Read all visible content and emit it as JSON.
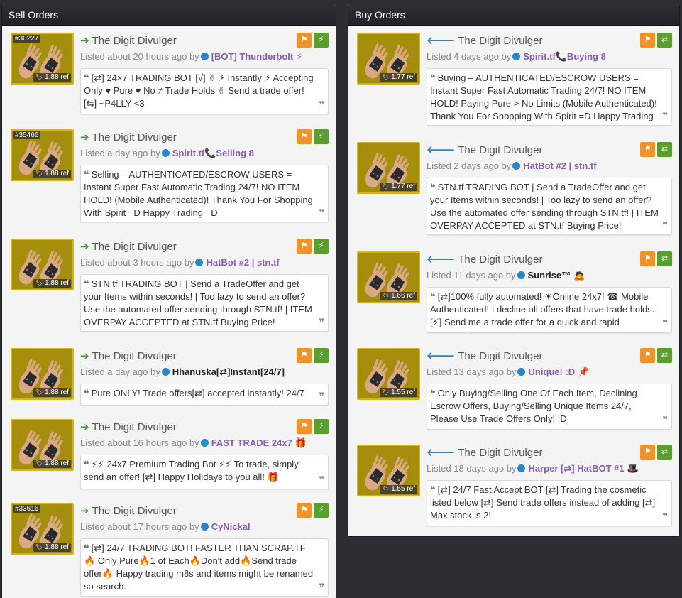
{
  "sell": {
    "title": "Sell Orders",
    "orders": [
      {
        "id": "#30227",
        "price": "1.88 ref",
        "item": "The Digit Divulger",
        "listed": "Listed about 20 hours ago by",
        "user": "[BOT] Thunderbolt",
        "user_emoji": "⚡",
        "desc": "[⇄] 24×7 TRADING BOT [√] ✌ ⚡ Instantly ⚡ Accepting Only ♥ Pure ♥ No ≠ Trade Holds ✌ Send a trade offer! [⇆] ~P4LLY <3"
      },
      {
        "id": "#35466",
        "price": "1.88 ref",
        "item": "The Digit Divulger",
        "listed": "Listed a day ago by",
        "user": "Spirit.tf📞Selling 8",
        "user_emoji": "",
        "desc": "Selling – AUTHENTICATED/ESCROW USERS = Instant Super Fast Automatic Trading 24/7! NO ITEM HOLD! (Mobile Authenticated)! Thank You For Shopping With Spirit =D Happy Trading =D"
      },
      {
        "id": "",
        "price": "1.88 ref",
        "item": "The Digit Divulger",
        "listed": "Listed about 3 hours ago by",
        "user": "HatBot #2 | stn.tf",
        "user_emoji": "",
        "desc": "STN.tf TRADING BOT | Send a TradeOffer and get your Items within seconds! | Too lazy to send an offer? Use the automated offer sending through STN.tf! | ITEM OVERPAY ACCEPTED at STN.tf Buying Price!"
      },
      {
        "id": "",
        "price": "1.88 ref",
        "item": "The Digit Divulger",
        "listed": "Listed a day ago by",
        "user": "Hhanuska[⇄]Instant[24/7]",
        "user_emoji": "",
        "desc": "Pure ONLY! Trade offers[⇄] accepted instantly! 24/7"
      },
      {
        "id": "",
        "price": "1.88 ref",
        "item": "The Digit Divulger",
        "listed": "Listed about 16 hours ago by",
        "user": "FAST TRADE 24x7",
        "user_emoji": "🎁",
        "desc": "⚡⚡ 24x7 Premium Trading Bot ⚡⚡ To trade, simply send an offer! [⇄] Happy Holidays to you all! 🎁"
      },
      {
        "id": "#33616",
        "price": "1.88 ref",
        "item": "The Digit Divulger",
        "listed": "Listed about 17 hours ago by",
        "user": "CyNickal",
        "user_emoji": "",
        "desc": "[⇄] 24/7 TRADING BOT! FASTER THAN SCRAP.TF 🔥 Only Pure🔥1 of Each🔥Don't add🔥Send trade offer🔥 Happy trading m8s and items might be renamed so search."
      }
    ]
  },
  "buy": {
    "title": "Buy Orders",
    "orders": [
      {
        "price": "1.77 ref",
        "item": "The Digit Divulger",
        "listed": "Listed 4 days ago by",
        "user": "Spirit.tf📞Buying 8",
        "user_emoji": "",
        "desc": "Buying – AUTHENTICATED/ESCROW USERS = Instant Super Fast Automatic Trading 24/7! NO ITEM HOLD! Paying Pure > No Limits (Mobile Authenticated)! Thank You For Shopping With Spirit =D Happy Trading =D"
      },
      {
        "price": "1.77 ref",
        "item": "The Digit Divulger",
        "listed": "Listed 2 days ago by",
        "user": "HatBot #2 | stn.tf",
        "user_emoji": "",
        "desc": "STN.tf TRADING BOT | Send a TradeOffer and get your Items within seconds! | Too lazy to send an offer? Use the automated offer sending through STN.tf! | ITEM OVERPAY ACCEPTED at STN.tf Buying Price!"
      },
      {
        "price": "1.66 ref",
        "item": "The Digit Divulger",
        "listed": "Listed 11 days ago by",
        "user": "Sunrise™",
        "user_emoji": "🙇",
        "desc": "[⇄]100% fully automated! ☀Online 24x7! ☎ Mobile Authenticated! I decline all offers that have trade holds. [⚡] Send me a trade offer for a quick and rapid response!"
      },
      {
        "price": "1.55 ref",
        "item": "The Digit Divulger",
        "listed": "Listed 13 days ago by",
        "user": "Unique! :D",
        "user_emoji": "📌",
        "desc": "Only Buying/Selling One Of Each Item, Declining Escrow Offers, Buying/Selling Unique Items 24/7, Please Use Trade Offers Only! :D"
      },
      {
        "price": "1.55 ref",
        "item": "The Digit Divulger",
        "listed": "Listed 18 days ago by",
        "user": "Harper [⇄] HatBOT #1",
        "user_emoji": "🎩",
        "desc": "[⇄] 24/7 Fast Accept BOT [⇄] Trading the cosmetic listed below [⇄] Send trade offers instead of adding [⇄] Max stock is 2!"
      }
    ]
  },
  "colors": {
    "flag": "#f0932b",
    "action": "#5a9e2f",
    "item_bg": "#a58e0c",
    "item_border": "#d5b417",
    "username": "#8c5bb5"
  },
  "icons": {
    "sell_arrow": "right-arrow-icon",
    "buy_arrow": "left-arrow-icon",
    "flag": "flag-icon",
    "bolt": "lightning-icon",
    "swap": "swap-icon",
    "status_dot": "status-dot-icon",
    "quote": "quote-icon"
  }
}
